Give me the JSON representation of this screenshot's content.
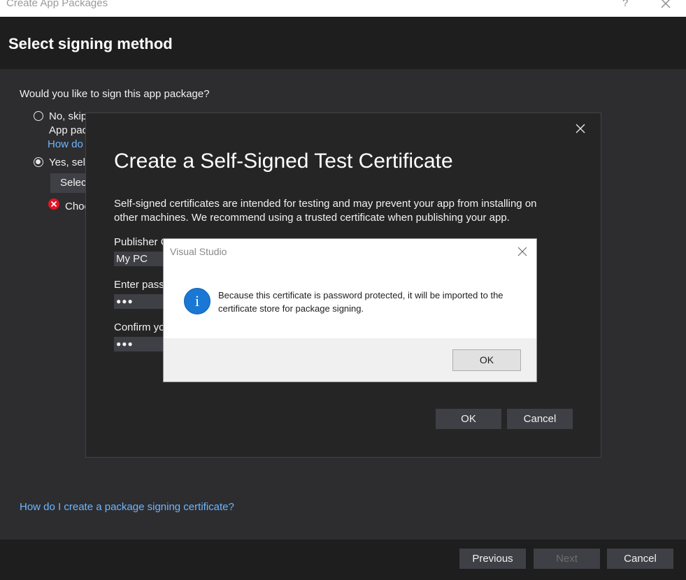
{
  "window": {
    "title": "Create App Packages",
    "help": "?"
  },
  "header": {
    "title": "Select signing method"
  },
  "main": {
    "question": "Would you like to sign this app package?",
    "option_no": {
      "label": "No, skip",
      "sub": "App pac",
      "link": "How do"
    },
    "option_yes": {
      "label": "Yes, sele"
    },
    "select_button": "Select",
    "error_text": "Choo",
    "bottom_link": "How do I create a package signing certificate?"
  },
  "footer": {
    "previous": "Previous",
    "next": "Next",
    "cancel": "Cancel"
  },
  "cert_dialog": {
    "title": "Create a Self-Signed Test Certificate",
    "description": "Self-signed certificates are intended for testing and may prevent your app from installing on other machines. We recommend using a trusted certificate when publishing your app.",
    "publisher_label": "Publisher C",
    "publisher_value": "My PC",
    "password_label": "Enter passw",
    "password_value": "●●●",
    "confirm_label": "Confirm yo",
    "confirm_value": "●●●",
    "ok": "OK",
    "cancel": "Cancel"
  },
  "message_box": {
    "title": "Visual Studio",
    "icon": "info-icon",
    "message": "Because this certificate is password protected, it will be imported to the certificate store for package signing.",
    "ok": "OK"
  },
  "colors": {
    "accent_link": "#6cb6ff",
    "info_blue": "#1a78d4",
    "error_red": "#e81123"
  }
}
